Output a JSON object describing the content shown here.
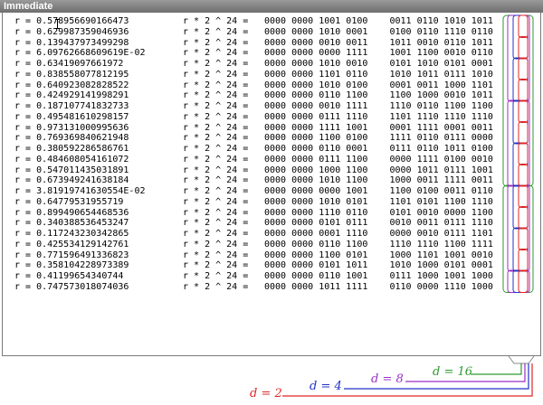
{
  "window": {
    "title": "Immediate"
  },
  "lines": [
    {
      "r": "r = 0.578956690166473",
      "expr": "r * 2 ^ 24 =",
      "bits": "0000 0000 1001 0100    0011 0110 1010 1011"
    },
    {
      "r": "r = 0.629987359046936",
      "expr": "r * 2 ^ 24 =",
      "bits": "0000 0000 1010 0001    0100 0110 1110 0110"
    },
    {
      "r": "r = 0.139437973499298",
      "expr": "r * 2 ^ 24 =",
      "bits": "0000 0000 0010 0011    1011 0010 0110 1011"
    },
    {
      "r": "r = 6.09762668609619E-02",
      "expr": "r * 2 ^ 24 =",
      "bits": "0000 0000 0000 1111    1001 1100 0010 0110"
    },
    {
      "r": "r = 0.63419097661972",
      "expr": "r * 2 ^ 24 =",
      "bits": "0000 0000 1010 0010    0101 1010 0101 0001"
    },
    {
      "r": "r = 0.838558077812195",
      "expr": "r * 2 ^ 24 =",
      "bits": "0000 0000 1101 0110    1010 1011 0111 1010"
    },
    {
      "r": "r = 0.640923082828522",
      "expr": "r * 2 ^ 24 =",
      "bits": "0000 0000 1010 0100    0001 0011 1000 1101"
    },
    {
      "r": "r = 0.424929141998291",
      "expr": "r * 2 ^ 24 =",
      "bits": "0000 0000 0110 1100    1100 1000 0010 1011"
    },
    {
      "r": "r = 0.187107741832733",
      "expr": "r * 2 ^ 24 =",
      "bits": "0000 0000 0010 1111    1110 0110 1100 1100"
    },
    {
      "r": "r = 0.495481610298157",
      "expr": "r * 2 ^ 24 =",
      "bits": "0000 0000 0111 1110    1101 1110 1110 1110"
    },
    {
      "r": "r = 0.973131000995636",
      "expr": "r * 2 ^ 24 =",
      "bits": "0000 0000 1111 1001    0001 1111 0001 0011"
    },
    {
      "r": "r = 0.769369840621948",
      "expr": "r * 2 ^ 24 =",
      "bits": "0000 0000 1100 0100    1111 0110 0111 0000"
    },
    {
      "r": "r = 0.380592286586761",
      "expr": "r * 2 ^ 24 =",
      "bits": "0000 0000 0110 0001    0111 0110 1011 0100"
    },
    {
      "r": "r = 0.484608054161072",
      "expr": "r * 2 ^ 24 =",
      "bits": "0000 0000 0111 1100    0000 1111 0100 0010"
    },
    {
      "r": "r = 0.547011435031891",
      "expr": "r * 2 ^ 24 =",
      "bits": "0000 0000 1000 1100    0000 1011 0111 1001"
    },
    {
      "r": "r = 0.673949241638184",
      "expr": "r * 2 ^ 24 =",
      "bits": "0000 0000 1010 1100    1000 0011 1111 0011"
    },
    {
      "r": "r = 3.81919741630554E-02",
      "expr": "r * 2 ^ 24 =",
      "bits": "0000 0000 0000 1001    1100 0100 0011 0110"
    },
    {
      "r": "r = 0.64779531955719",
      "expr": "r * 2 ^ 24 =",
      "bits": "0000 0000 1010 0101    1101 0101 1100 1110"
    },
    {
      "r": "r = 0.899490654468536",
      "expr": "r * 2 ^ 24 =",
      "bits": "0000 0000 1110 0110    0101 0010 0000 1100"
    },
    {
      "r": "r = 0.340388536453247",
      "expr": "r * 2 ^ 24 =",
      "bits": "0000 0000 0101 0111    0010 0011 0111 1110"
    },
    {
      "r": "r = 0.117243230342865",
      "expr": "r * 2 ^ 24 =",
      "bits": "0000 0000 0001 1110    0000 0010 0111 1101"
    },
    {
      "r": "r = 0.425534129142761",
      "expr": "r * 2 ^ 24 =",
      "bits": "0000 0000 0110 1100    1110 1110 1100 1111"
    },
    {
      "r": "r = 0.771596491336823",
      "expr": "r * 2 ^ 24 =",
      "bits": "0000 0000 1100 0101    1000 1101 1001 0010"
    },
    {
      "r": "r = 0.358104228973389",
      "expr": "r * 2 ^ 24 =",
      "bits": "0000 0000 0101 1011    1010 1000 0101 0001"
    },
    {
      "r": "r = 0.41199654340744",
      "expr": "r * 2 ^ 24 =",
      "bits": "0000 0000 0110 1001    0111 1000 1001 1000"
    },
    {
      "r": "r = 0.747573018074036",
      "expr": "r * 2 ^ 24 =",
      "bits": "0000 0000 1011 1111    0110 0000 1110 1000"
    }
  ],
  "legend": [
    {
      "text": "d = 16",
      "color": "#2e9a2e",
      "run": 16
    },
    {
      "text": "d = 8",
      "color": "#9b2fc7",
      "run": 8
    },
    {
      "text": "d = 4",
      "color": "#2233c8",
      "run": 4
    },
    {
      "text": "d = 2",
      "color": "#e02525",
      "run": 2
    }
  ]
}
